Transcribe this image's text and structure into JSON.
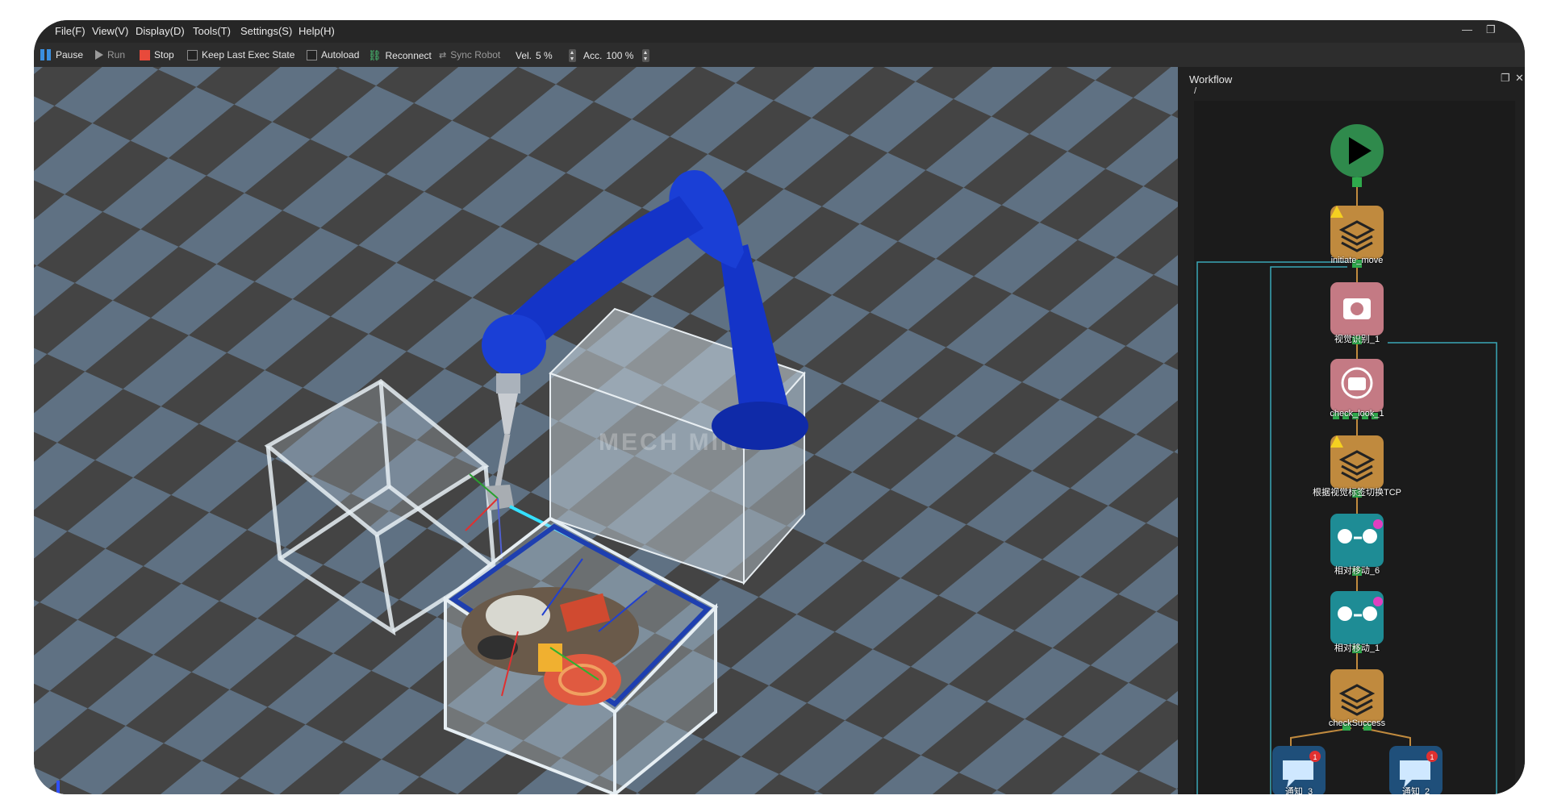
{
  "menu": {
    "items": [
      "File(F)",
      "View(V)",
      "Display(D)",
      "Tools(T)",
      "Settings(S)",
      "Help(H)"
    ]
  },
  "toolbar": {
    "pause": "Pause",
    "run": "Run",
    "stop": "Stop",
    "keep_last": "Keep Last Exec State",
    "autoload": "Autoload",
    "reconnect": "Reconnect",
    "sync_robot": "Sync Robot",
    "vel_label": "Vel.",
    "vel_value": "5 %",
    "acc_label": "Acc.",
    "acc_value": "100 %"
  },
  "viewport": {
    "watermark": "MECH MIND"
  },
  "workflow": {
    "title": "Workflow",
    "path": "/",
    "nodes": [
      {
        "label": "",
        "kind": "start",
        "color": "#2f8a4c"
      },
      {
        "label": "initiate_move",
        "kind": "layers",
        "color": "#c08a3e",
        "warning": true
      },
      {
        "label": "视觉识别_1",
        "kind": "camera",
        "color": "#c47a84"
      },
      {
        "label": "check_look_1",
        "kind": "camera-check",
        "color": "#c47a84"
      },
      {
        "label": "根据视觉标签切换TCP",
        "kind": "layers",
        "color": "#c08a3e",
        "warning": true
      },
      {
        "label": "相对移动_6",
        "kind": "move",
        "color": "#1e8c95"
      },
      {
        "label": "相对移动_1",
        "kind": "move",
        "color": "#1e8c95"
      },
      {
        "label": "checkSuccess",
        "kind": "layers",
        "color": "#c08a3e"
      },
      {
        "label": "通知_3",
        "kind": "notify",
        "color": "#1f4f7a",
        "badge": "1"
      },
      {
        "label": "通知_2",
        "kind": "notify",
        "color": "#1f4f7a",
        "badge": "1"
      }
    ]
  },
  "colors": {
    "robot": "#1434c8",
    "accent": "#2f8a4c",
    "stop": "#e84a3b",
    "pause": "#3a8fe0"
  }
}
